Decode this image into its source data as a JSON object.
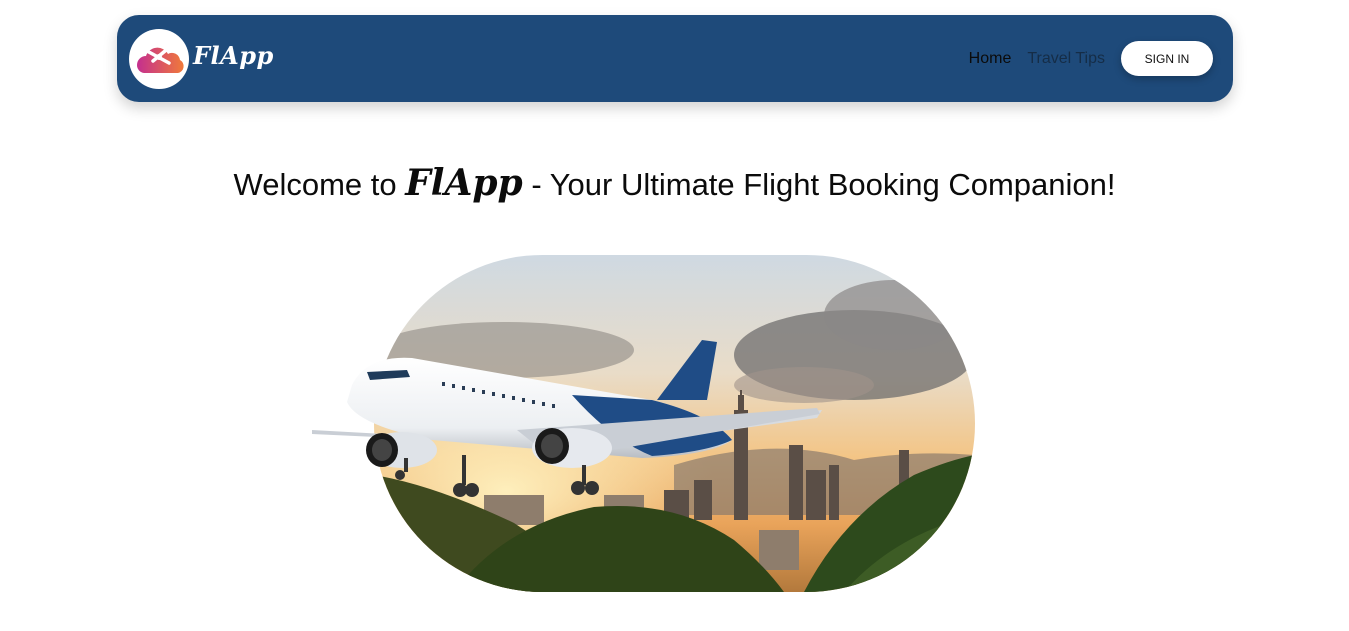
{
  "brand": {
    "name": "FlApp"
  },
  "nav": {
    "links": [
      {
        "label": "Home",
        "active": true
      },
      {
        "label": "Travel Tips",
        "active": false
      }
    ],
    "signin_label": "SIGN IN"
  },
  "headline": {
    "prefix": "Welcome to ",
    "brand": "FlApp",
    "suffix": " - Your Ultimate Flight Booking Companion!"
  },
  "colors": {
    "navbar": "#1e4a7a",
    "text": "#0b0b0b",
    "logo_gradient_start": "#d6338f",
    "logo_gradient_end": "#f07a3a"
  },
  "hero": {
    "icon": "airplane-over-city-image"
  }
}
